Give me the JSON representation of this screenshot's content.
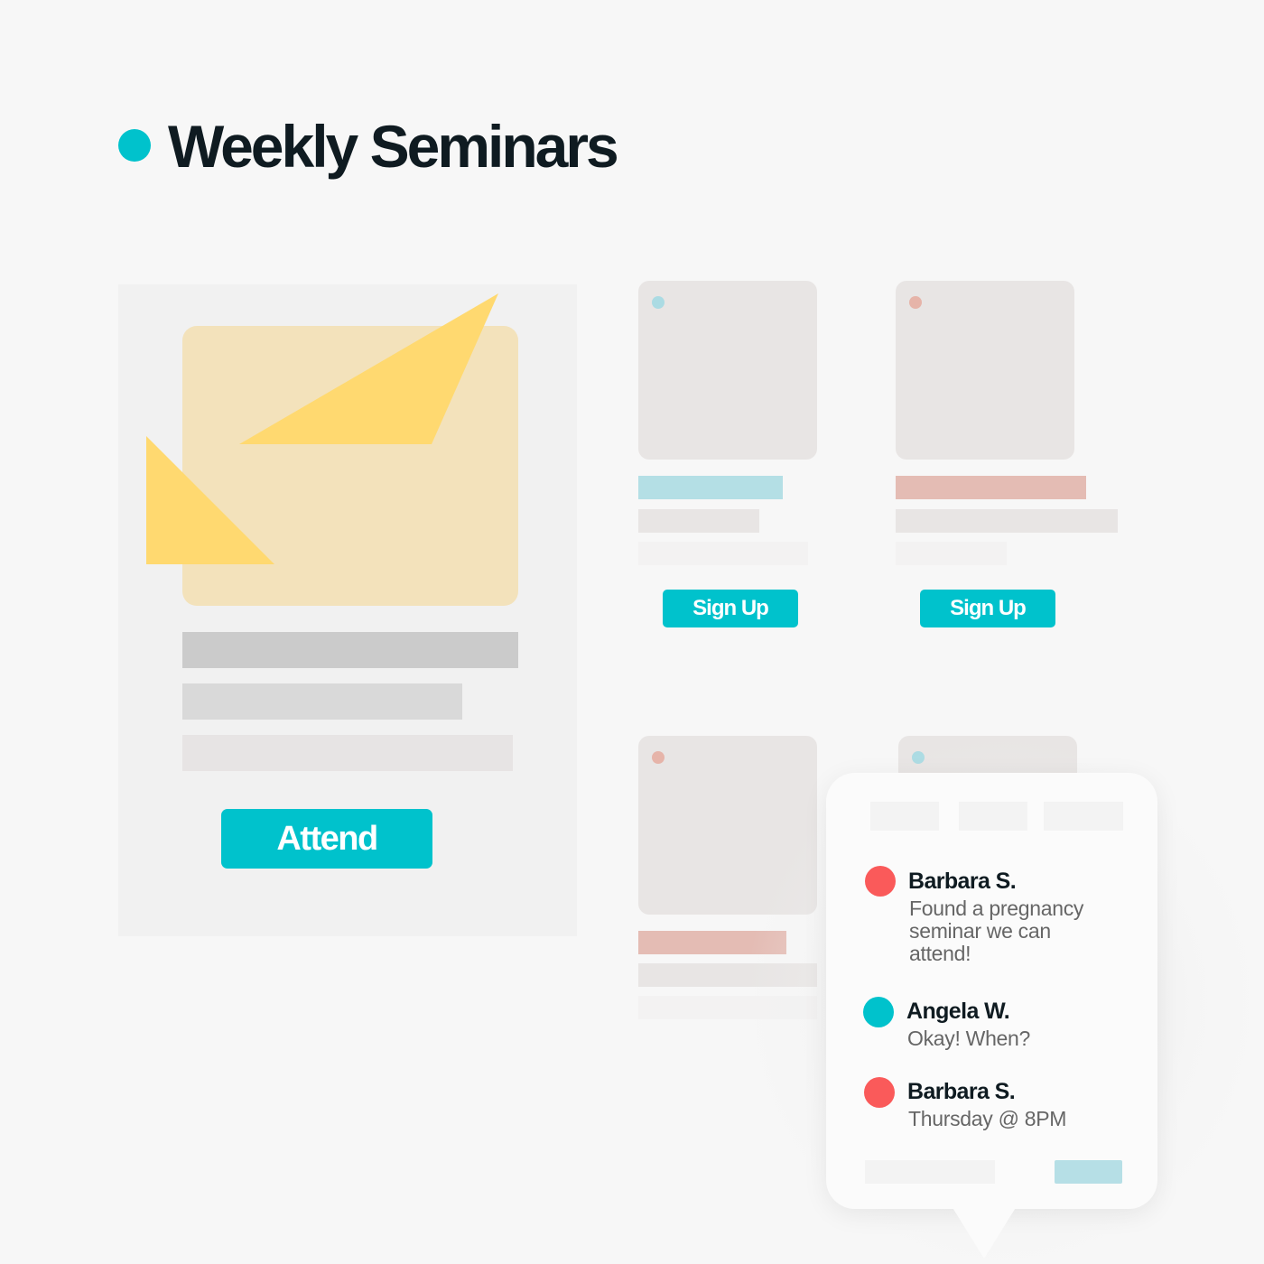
{
  "header": {
    "title": "Weekly Seminars"
  },
  "featured": {
    "attend_label": "Attend"
  },
  "cards": [
    {
      "accent": "#b4dfe5",
      "dot": "#abdbe3",
      "button_label": "Sign Up"
    },
    {
      "accent": "#e4bcb4",
      "dot": "#e6b4a9",
      "button_label": "Sign Up"
    },
    {
      "accent": "#e4bcb4",
      "dot": "#e6b4a9"
    },
    {
      "dot": "#abdbe3"
    }
  ],
  "chat": {
    "messages": [
      {
        "name": "Barbara S.",
        "text": "Found a pregnancy seminar we can attend!",
        "avatar_color": "#fa5a5a"
      },
      {
        "name": "Angela W.",
        "text": "Okay! When?",
        "avatar_color": "#00c2cc"
      },
      {
        "name": "Barbara S.",
        "text": "Thursday @ 8PM",
        "avatar_color": "#fa5a5a"
      }
    ]
  },
  "colors": {
    "accent": "#00c2cc",
    "title_text": "#0f1b21",
    "art_background": "#f3e2bb",
    "art_shape": "#ffd970"
  },
  "icons": {
    "title_marker": "dot-icon"
  }
}
